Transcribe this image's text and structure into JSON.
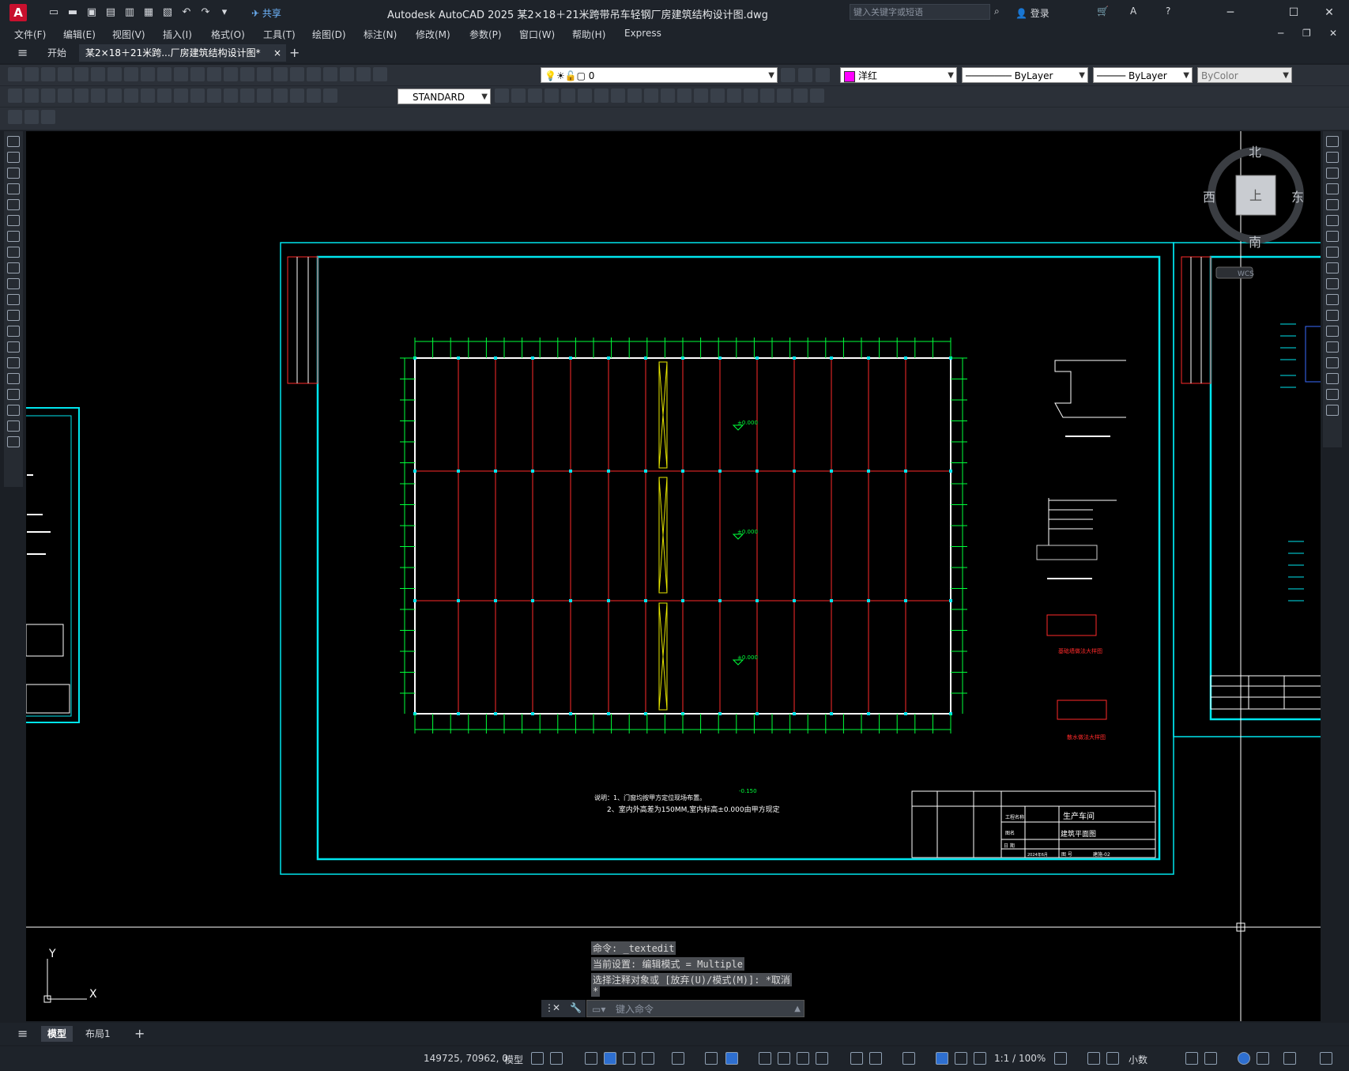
{
  "app": {
    "logo_letter": "A",
    "share_label": "共享",
    "title": "Autodesk AutoCAD 2025    某2×18＋21米跨带吊车轻钢厂房建筑结构设计图.dwg",
    "search_placeholder": "键入关键字或短语",
    "login_label": "登录"
  },
  "menu": [
    "文件(F)",
    "编辑(E)",
    "视图(V)",
    "插入(I)",
    "格式(O)",
    "工具(T)",
    "绘图(D)",
    "标注(N)",
    "修改(M)",
    "参数(P)",
    "窗口(W)",
    "帮助(H)",
    "Express"
  ],
  "doc_tabs": {
    "start": "开始",
    "active": "某2×18＋21米跨...厂房建筑结构设计图*",
    "close_icon": "×",
    "add_icon": "+"
  },
  "properties": {
    "layer_value": "0",
    "color_value": "洋红",
    "color_hex": "#ff00ff",
    "linetype_value": "ByLayer",
    "lineweight_value": "ByLayer",
    "plotstyle_value": "ByColor",
    "textstyle_value": "STANDARD"
  },
  "viewcube": {
    "north": "北",
    "south": "南",
    "east": "东",
    "west": "西",
    "face": "上",
    "wcs": "WCS"
  },
  "ucs": {
    "x": "X",
    "y": "Y"
  },
  "drawing": {
    "note_line1": "说明：1、门窗均按甲方定位现场布置。",
    "note_line2": "2、室内外高差为150MM,室内标高±0.000由甲方现定",
    "elev_marks": [
      "±0.000",
      "±0.000",
      "±0.000",
      "-0.150"
    ],
    "tb_project": "工程名称",
    "tb_name": "生产车间",
    "tb_drawing": "图名",
    "tb_drawing_name": "建筑平面图",
    "tb_date_label": "日 期",
    "tb_date": "2024年6月",
    "tb_no_label": "图 号",
    "tb_no": "建施-02",
    "detail1": "基础墙做法大样图",
    "detail2": "散水做法大样图"
  },
  "command": {
    "line1": "命令: _textedit",
    "line2": "当前设置: 编辑模式 = Multiple",
    "line3": "选择注释对象或 [放弃(U)/模式(M)]: *取消",
    "line4": "*",
    "input_placeholder": "键入命令"
  },
  "layout_tabs": {
    "model": "模型",
    "layout1": "布局1",
    "add": "+"
  },
  "status": {
    "coords": "149725, 70962, 0",
    "model_label": "模型",
    "scale": "1:1 / 100%",
    "units": "小数"
  },
  "colors": {
    "frame": "#00e5ee",
    "grid_red": "#ff2a2a",
    "dim_green": "#00ff3a",
    "wall_white": "#ffffff",
    "crane_yellow": "#e6e600"
  }
}
